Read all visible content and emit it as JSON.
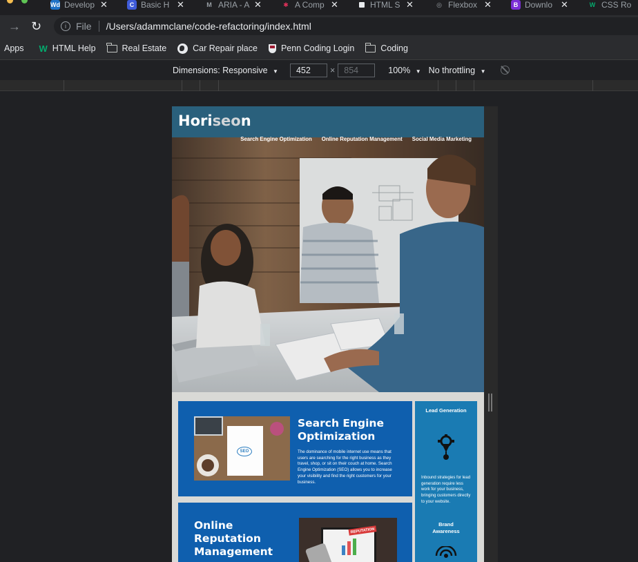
{
  "tabs": [
    {
      "icon": "wd-favicon-icon",
      "label": "Develop",
      "color": "#1e72c6",
      "mark": "Wd"
    },
    {
      "icon": "codeacademy-favicon-icon",
      "label": "Basic H",
      "color": "#3f5bd8",
      "mark": "C"
    },
    {
      "icon": "mdn-favicon-icon",
      "label": "ARIA - A",
      "color": "#1f1f22",
      "mark": "M"
    },
    {
      "icon": "asterisk-favicon-icon",
      "label": "A Comp",
      "color": "#1f1f22",
      "mark": "✱"
    },
    {
      "icon": "doc-favicon-icon",
      "label": "HTML S",
      "color": "#e8eaed",
      "mark": ""
    },
    {
      "icon": "globe-favicon-icon",
      "label": "Flexbox",
      "color": "#1f1f22",
      "mark": "◎"
    },
    {
      "icon": "bootstrap-favicon-icon",
      "label": "Downlo",
      "color": "#7b2ed6",
      "mark": "B"
    },
    {
      "icon": "w3-favicon-icon",
      "label": "CSS Ro",
      "color": "#1f1f22",
      "mark": "W"
    }
  ],
  "address": {
    "scheme": "File",
    "url": "/Users/adammclane/code-refactoring/index.html"
  },
  "bookmarks": {
    "apps": "Apps",
    "items": [
      {
        "label": "HTML Help",
        "icon": "w3-icon"
      },
      {
        "label": "Real Estate",
        "icon": "folder-icon"
      },
      {
        "label": "Car Repair place",
        "icon": "globe-icon"
      },
      {
        "label": "Penn Coding Login",
        "icon": "penn-shield-icon"
      },
      {
        "label": "Coding",
        "icon": "folder-icon"
      }
    ]
  },
  "devtools": {
    "dimensions": "Dimensions: Responsive",
    "width": "452",
    "times": "×",
    "height": "854",
    "zoom": "100%",
    "throttling": "No throttling"
  },
  "site": {
    "logo_a": "Hori",
    "logo_b": "seo",
    "logo_c": "n",
    "nav": [
      "Search Engine Optimization",
      "Online Reputation Management",
      "Social Media Marketing"
    ],
    "seo": {
      "title": "Search Engine Optimization",
      "body": "The dominance of mobile internet use means that users are searching for the right business as they travel, shop, or sit on their couch at home. Search Engine Optimization (SEO) allows you to increase your visibility and find the right customers for your business.",
      "image_text": "SEO"
    },
    "orm": {
      "title": "Online Reputation Management",
      "image_text": "REPUTATION"
    },
    "aside": {
      "lead_title": "Lead Generation",
      "lead_body": "Inbound strategies for lead generation require less work for your business, bringing customers directly to your website.",
      "brand_title": "Brand Awareness"
    }
  }
}
